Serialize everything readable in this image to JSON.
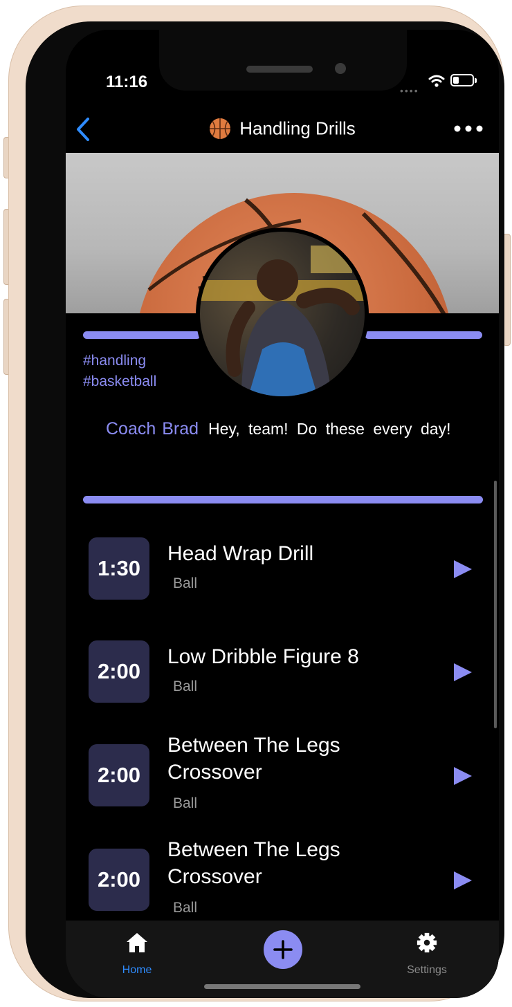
{
  "status_bar": {
    "time": "11:16"
  },
  "header": {
    "title": "Handling Drills"
  },
  "post": {
    "tags": [
      "#handling",
      "#basketball"
    ],
    "author": "Coach Brad",
    "message": "Hey, team!  Do these every day!"
  },
  "drills": [
    {
      "duration": "1:30",
      "name": "Head Wrap Drill",
      "equipment": "Ball"
    },
    {
      "duration": "2:00",
      "name": "Low Dribble Figure 8",
      "equipment": "Ball"
    },
    {
      "duration": "2:00",
      "name": "Between The Legs Crossover",
      "equipment": "Ball"
    },
    {
      "duration": "2:00",
      "name": "Between The Legs Crossover",
      "equipment": "Ball"
    }
  ],
  "tabbar": {
    "home_label": "Home",
    "settings_label": "Settings"
  },
  "colors": {
    "accent": "#8b8cf2",
    "active_tab": "#2f8cff",
    "timebox": "#2c2c4c",
    "frame": "#f0dccb"
  },
  "icons": {
    "back": "chevron-left-icon",
    "title": "basketball-icon",
    "more": "ellipsis-icon",
    "play": "play-icon",
    "home": "home-icon",
    "add": "plus-icon",
    "settings": "gear-icon"
  }
}
